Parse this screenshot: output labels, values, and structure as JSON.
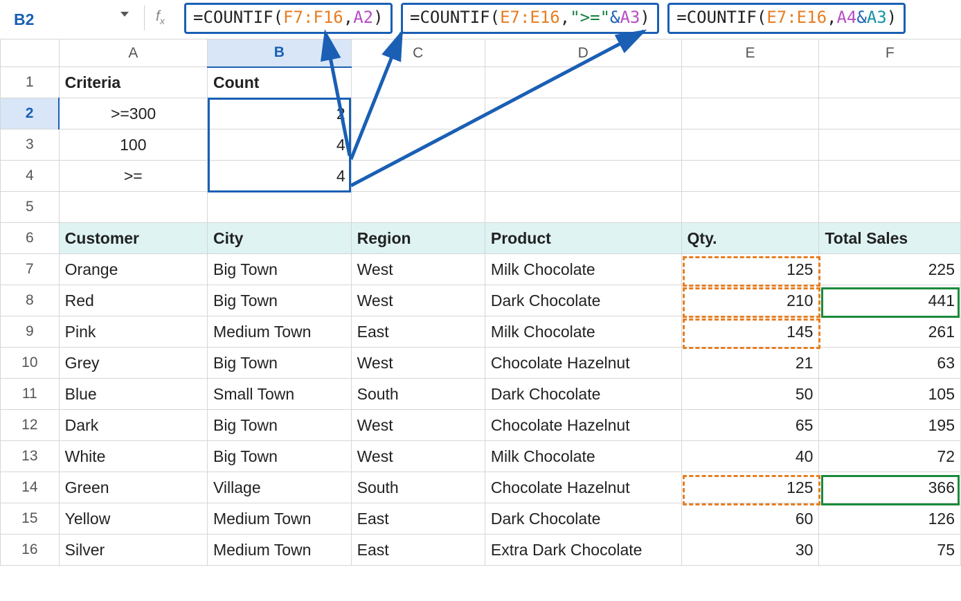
{
  "namebox": "B2",
  "fx_label": "fx",
  "callouts": {
    "c1": {
      "eq": "=",
      "fn": "COUNTIF(",
      "rng": "F7:F16",
      "comma": ",",
      "crit": "A2",
      "close": ")"
    },
    "c2": {
      "eq": "=",
      "fn": "COUNTIF(",
      "rng": "E7:E16",
      "comma": ",",
      "str": "\">=\"",
      "amp": "&",
      "crit": "A3",
      "close": ")"
    },
    "c3": {
      "eq": "=",
      "fn": "COUNTIF(",
      "rng": "E7:E16",
      "comma": ",",
      "crit": "A4",
      "amp": "&",
      "crit2": "A3",
      "close": ")"
    }
  },
  "colheads": {
    "A": "A",
    "B": "B",
    "C": "C",
    "D": "D",
    "E": "E",
    "F": "F"
  },
  "rows": {
    "1": {
      "n": "1"
    },
    "2": {
      "n": "2"
    },
    "3": {
      "n": "3"
    },
    "4": {
      "n": "4"
    },
    "5": {
      "n": "5"
    },
    "6": {
      "n": "6"
    },
    "7": {
      "n": "7"
    },
    "8": {
      "n": "8"
    },
    "9": {
      "n": "9"
    },
    "10": {
      "n": "10"
    },
    "11": {
      "n": "11"
    },
    "12": {
      "n": "12"
    },
    "13": {
      "n": "13"
    },
    "14": {
      "n": "14"
    },
    "15": {
      "n": "15"
    },
    "16": {
      "n": "16"
    }
  },
  "cells": {
    "A1": "Criteria",
    "B1": "Count",
    "A2": ">=300",
    "B2": "2",
    "A3": "100",
    "B3": "4",
    "A4": ">=",
    "B4": "4",
    "A6": "Customer",
    "B6": "City",
    "C6": "Region",
    "D6": "Product",
    "E6": "Qty.",
    "F6": "Total Sales",
    "A7": "Orange",
    "B7": "Big Town",
    "C7": "West",
    "D7": "Milk Chocolate",
    "E7": "125",
    "F7": "225",
    "A8": "Red",
    "B8": "Big Town",
    "C8": "West",
    "D8": "Dark Chocolate",
    "E8": "210",
    "F8": "441",
    "A9": "Pink",
    "B9": "Medium Town",
    "C9": "East",
    "D9": "Milk Chocolate",
    "E9": "145",
    "F9": "261",
    "A10": "Grey",
    "B10": "Big Town",
    "C10": "West",
    "D10": "Chocolate Hazelnut",
    "E10": "21",
    "F10": "63",
    "A11": "Blue",
    "B11": "Small Town",
    "C11": "South",
    "D11": "Dark Chocolate",
    "E11": "50",
    "F11": "105",
    "A12": "Dark",
    "B12": "Big Town",
    "C12": "West",
    "D12": "Chocolate Hazelnut",
    "E12": "65",
    "F12": "195",
    "A13": "White",
    "B13": "Big Town",
    "C13": "West",
    "D13": "Milk Chocolate",
    "E13": "40",
    "F13": "72",
    "A14": "Green",
    "B14": "Village",
    "C14": "South",
    "D14": "Chocolate Hazelnut",
    "E14": "125",
    "F14": "366",
    "A15": "Yellow",
    "B15": "Medium Town",
    "C15": "East",
    "D15": "Dark Chocolate",
    "E15": "60",
    "F15": "126",
    "A16": "Silver",
    "B16": "Medium Town",
    "C16": "East",
    "D16": "Extra Dark Chocolate",
    "E16": "30",
    "F16": "75"
  }
}
